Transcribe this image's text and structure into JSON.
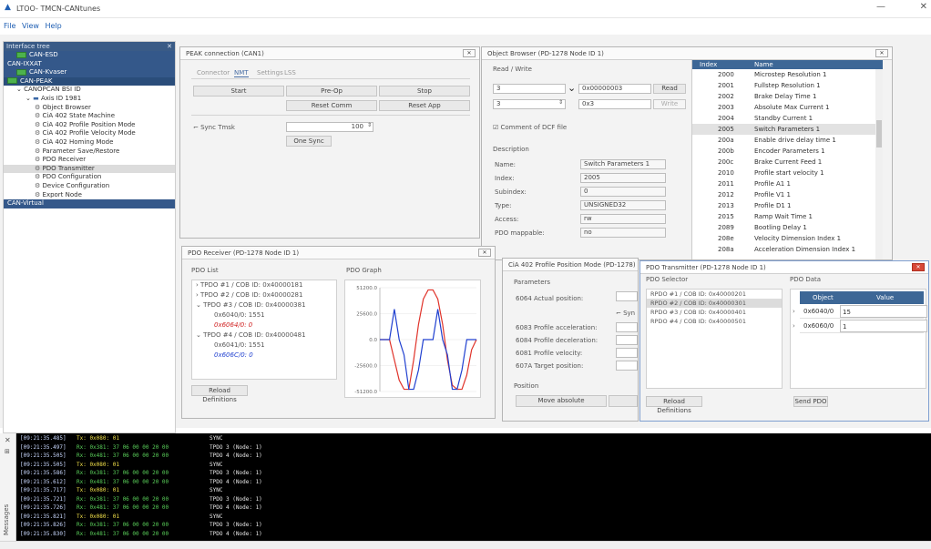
{
  "app": {
    "title": "LTOO- TMCN-CANtunes"
  },
  "menu": [
    "File",
    "View",
    "Help"
  ],
  "tree": {
    "header": "Interface tree",
    "items": [
      {
        "label": "CAN-ESD",
        "depth": 1,
        "style": "blue",
        "icon": "can-device-icon"
      },
      {
        "label": "CAN-IXXAT",
        "depth": 0,
        "style": "blue"
      },
      {
        "label": "CAN-Kvaser",
        "depth": 1,
        "style": "blue",
        "icon": "can-device-icon"
      },
      {
        "label": "CAN-PEAK",
        "depth": 0,
        "style": "blue-dark",
        "icon": "can-device-icon"
      },
      {
        "label": "CANOPCAN BSI ID",
        "depth": 1,
        "style": "plain"
      },
      {
        "label": "Axis ID 1981",
        "depth": 2,
        "style": "plain"
      },
      {
        "label": "Object Browser",
        "depth": 3,
        "style": "plain"
      },
      {
        "label": "CiA 402 State Machine",
        "depth": 3,
        "style": "plain"
      },
      {
        "label": "CiA 402 Profile Position Mode",
        "depth": 3,
        "style": "plain"
      },
      {
        "label": "CiA 402 Profile Velocity Mode",
        "depth": 3,
        "style": "plain"
      },
      {
        "label": "CiA 402 Homing Mode",
        "depth": 3,
        "style": "plain"
      },
      {
        "label": "Parameter Save/Restore",
        "depth": 3,
        "style": "plain"
      },
      {
        "label": "PDO Receiver",
        "depth": 3,
        "style": "plain"
      },
      {
        "label": "PDO Transmitter",
        "depth": 3,
        "style": "selected"
      },
      {
        "label": "PDO Configuration",
        "depth": 3,
        "style": "plain"
      },
      {
        "label": "Device Configuration",
        "depth": 3,
        "style": "plain"
      },
      {
        "label": "Export Node",
        "depth": 3,
        "style": "plain"
      },
      {
        "label": "CAN-Virtual",
        "depth": 0,
        "style": "blue"
      }
    ]
  },
  "peak": {
    "title": "PEAK connection (CAN1)",
    "tabs": [
      "Connector",
      "NMT",
      "Settings",
      "LSS"
    ],
    "buttons": [
      "Start",
      "Pre-Op",
      "Stop",
      "Reset Comm",
      "Reset App"
    ],
    "sync_label": "Sync Tmsk",
    "sync_value": "100",
    "one_sync": "One Sync"
  },
  "object_browser": {
    "title": "Object Browser (PD-1278 Node ID 1)",
    "read_write": "Read / Write",
    "index_value": "3",
    "index_hex": "0x00000003",
    "read": "Read",
    "sub_value": "3",
    "sub_hex": "0x3",
    "write": "Write",
    "comment": "Comment of DCF file",
    "description": "Description",
    "fields": [
      {
        "label": "Name:",
        "value": "Switch Parameters 1"
      },
      {
        "label": "Index:",
        "value": "2005"
      },
      {
        "label": "Subindex:",
        "value": "0"
      },
      {
        "label": "Type:",
        "value": "UNSIGNED32"
      },
      {
        "label": "Access:",
        "value": "rw"
      },
      {
        "label": "PDO mappable:",
        "value": "no"
      }
    ],
    "columns": [
      "Index",
      "Name"
    ],
    "rows": [
      {
        "index": "2000",
        "name": "Microstep Resolution 1"
      },
      {
        "index": "2001",
        "name": "Fullstep Resolution 1"
      },
      {
        "index": "2002",
        "name": "Brake Delay Time 1"
      },
      {
        "index": "2003",
        "name": "Absolute Max Current 1"
      },
      {
        "index": "2004",
        "name": "Standby Current 1"
      },
      {
        "index": "2005",
        "name": "Switch Parameters 1"
      },
      {
        "index": "200a",
        "name": "Enable drive delay time 1"
      },
      {
        "index": "200b",
        "name": "Encoder Parameters 1"
      },
      {
        "index": "200c",
        "name": "Brake Current Feed 1"
      },
      {
        "index": "2010",
        "name": "Profile start velocity 1"
      },
      {
        "index": "2011",
        "name": "Profile A1 1"
      },
      {
        "index": "2012",
        "name": "Profile V1 1"
      },
      {
        "index": "2013",
        "name": "Profile D1 1"
      },
      {
        "index": "2015",
        "name": "Ramp Wait Time 1"
      },
      {
        "index": "2089",
        "name": "Bootling Delay 1"
      },
      {
        "index": "208e",
        "name": "Velocity Dimension Index 1"
      },
      {
        "index": "208a",
        "name": "Acceleration Dimension Index 1"
      }
    ]
  },
  "pdo_receiver": {
    "title": "PDO Receiver (PD-1278 Node ID 1)",
    "list_label": "PDO List",
    "graph_label": "PDO Graph",
    "items": [
      {
        "text": "TPDO #1 / COB ID: 0x40000181",
        "depth": 0,
        "color": "#555"
      },
      {
        "text": "TPDO #2 / COB ID: 0x40000281",
        "depth": 0,
        "color": "#555"
      },
      {
        "text": "TPDO #3 / COB ID: 0x40000381",
        "depth": 0,
        "color": "#555"
      },
      {
        "text": "0x6040/0: 1551",
        "depth": 1,
        "color": "#555"
      },
      {
        "text": "0x6064/0: 0",
        "depth": 1,
        "color": "#d02020"
      },
      {
        "text": "TPDO #4 / COB ID: 0x40000481",
        "depth": 0,
        "color": "#555"
      },
      {
        "text": "0x6041/0: 1551",
        "depth": 1,
        "color": "#555"
      },
      {
        "text": "0x606C/0: 0",
        "depth": 1,
        "color": "#2040d0"
      }
    ],
    "reload": "Reload Definitions",
    "yticks": [
      "51200.0",
      "25600.0",
      "0.0",
      "-25600.0",
      "-51200.0"
    ]
  },
  "chart_data": {
    "type": "line",
    "ylim": [
      -51200,
      51200
    ],
    "yticks": [
      51200,
      25600,
      0,
      -25600,
      -51200
    ],
    "x": [
      0,
      2,
      4,
      6,
      8,
      10,
      12,
      14,
      16,
      18,
      20,
      22,
      24,
      26,
      28,
      30,
      32,
      34,
      36,
      38,
      40
    ],
    "series": [
      {
        "color": "#e0332a",
        "values": [
          0,
          0,
          0,
          -20000,
          -40000,
          -49000,
          -49000,
          -20000,
          15000,
          40000,
          49000,
          49000,
          40000,
          15000,
          -20000,
          -45000,
          -49000,
          -49000,
          -35000,
          -10000,
          0
        ]
      },
      {
        "color": "#2040d0",
        "values": [
          0,
          0,
          0,
          30000,
          0,
          -15000,
          -49000,
          -49000,
          -30000,
          0,
          0,
          0,
          30000,
          0,
          -15000,
          -49000,
          -49000,
          -30000,
          0,
          0,
          0
        ]
      }
    ]
  },
  "profile_position": {
    "title": "CiA 402 Profile Position Mode (PD-1278)",
    "params_label": "Parameters",
    "fields": [
      "6064 Actual position:",
      "6083 Profile acceleration:",
      "6084 Profile deceleration:",
      "6081 Profile velocity:",
      "607A Target position:"
    ],
    "sync_label": "Syn",
    "position_label": "Position",
    "move_button": "Move absolute"
  },
  "pdo_transmitter": {
    "title": "PDO Transmitter (PD-1278 Node ID 1)",
    "selector_label": "PDO Selector",
    "data_label": "PDO Data",
    "items": [
      "RPDO #1 / COB ID: 0x40000201",
      "RPDO #2 / COB ID: 0x40000301",
      "RPDO #3 / COB ID: 0x40000401",
      "RPDO #4 / COB ID: 0x40000501"
    ],
    "columns": [
      "Object",
      "Value"
    ],
    "rows": [
      {
        "object": "0x6040/0",
        "value": "15"
      },
      {
        "object": "0x6060/0",
        "value": "1"
      }
    ],
    "reload": "Reload Definitions",
    "send": "Send PDO"
  },
  "console": {
    "lines": [
      {
        "time": "[09:21:35.485]",
        "kind": "Tx",
        "msg": "Tx: 0x080: 01",
        "desc": "SYNC"
      },
      {
        "time": "[09:21:35.497]",
        "kind": "Rx",
        "msg": "Rx: 0x381: 37 06 00 00 20 00",
        "desc": "TPDO 3 (Node: 1)"
      },
      {
        "time": "[09:21:35.505]",
        "kind": "Rx",
        "msg": "Rx: 0x481: 37 06 00 00 20 00",
        "desc": "TPDO 4 (Node: 1)"
      },
      {
        "time": "[09:21:35.505]",
        "kind": "Tx",
        "msg": "Tx: 0x080: 01",
        "desc": "SYNC"
      },
      {
        "time": "[09:21:35.586]",
        "kind": "Rx",
        "msg": "Rx: 0x381: 37 06 00 00 20 00",
        "desc": "TPDO 3 (Node: 1)"
      },
      {
        "time": "[09:21:35.612]",
        "kind": "Rx",
        "msg": "Rx: 0x481: 37 06 00 00 20 00",
        "desc": "TPDO 4 (Node: 1)"
      },
      {
        "time": "[09:21:35.717]",
        "kind": "Tx",
        "msg": "Tx: 0x080: 01",
        "desc": "SYNC"
      },
      {
        "time": "[09:21:35.721]",
        "kind": "Rx",
        "msg": "Rx: 0x381: 37 06 00 00 20 00",
        "desc": "TPDO 3 (Node: 1)"
      },
      {
        "time": "[09:21:35.726]",
        "kind": "Rx",
        "msg": "Rx: 0x481: 37 06 00 00 20 00",
        "desc": "TPDO 4 (Node: 1)"
      },
      {
        "time": "[09:21:35.821]",
        "kind": "Tx",
        "msg": "Tx: 0x080: 01",
        "desc": "SYNC"
      },
      {
        "time": "[09:21:35.826]",
        "kind": "Rx",
        "msg": "Rx: 0x381: 37 06 00 00 20 00",
        "desc": "TPDO 3 (Node: 1)"
      },
      {
        "time": "[09:21:35.830]",
        "kind": "Rx",
        "msg": "Rx: 0x481: 37 06 00 00 20 00",
        "desc": "TPDO 4 (Node: 1)"
      }
    ],
    "side_label": "Messages",
    "colors": {
      "Tx": "#f2e14a",
      "Rx": "#5ad05a",
      "time": "#c9d8ff",
      "desc": "#e8e8e8"
    }
  }
}
